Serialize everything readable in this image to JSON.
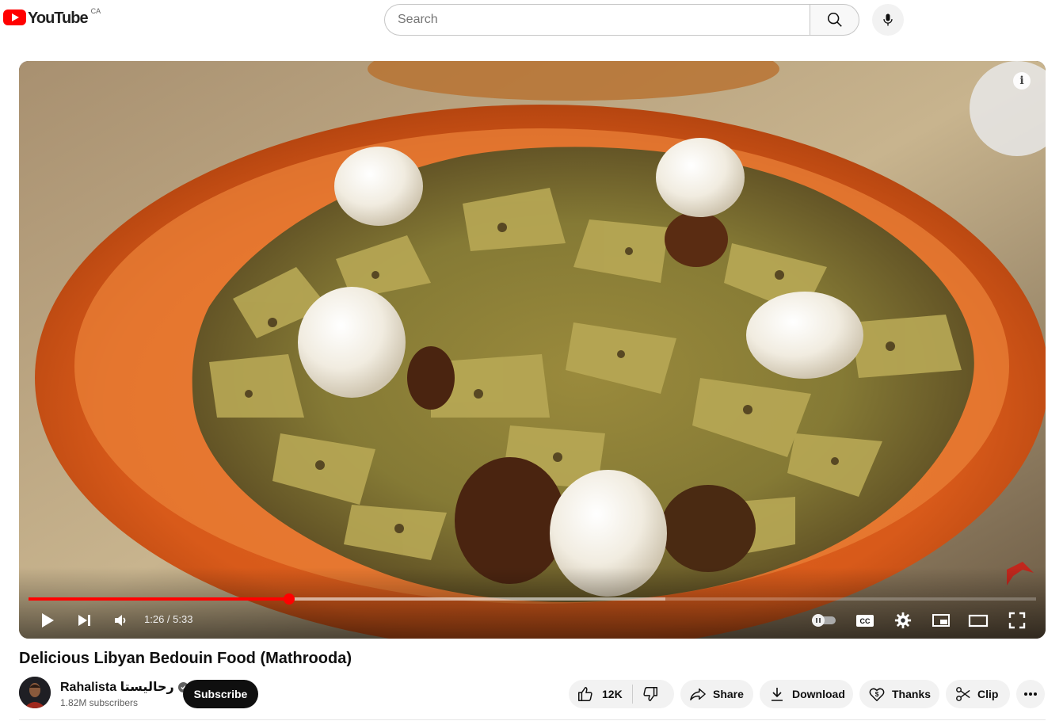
{
  "header": {
    "logo_text": "YouTube",
    "country_code": "CA",
    "search_placeholder": "Search",
    "icons": [
      "youtube-logo-icon",
      "search-icon",
      "microphone-icon"
    ]
  },
  "player": {
    "current_time": "1:26",
    "duration": "5:33",
    "time_display": "1:26 / 5:33",
    "played_fraction": 0.2584,
    "buffered_fraction": 0.6321,
    "accent_color": "#ff0000",
    "icons": [
      "info-icon",
      "play-icon",
      "next-icon",
      "volume-icon",
      "autoplay-toggle-icon",
      "captions-icon",
      "settings-icon",
      "miniplayer-icon",
      "theater-mode-icon",
      "fullscreen-icon",
      "channel-watermark-icon"
    ]
  },
  "video": {
    "title": "Delicious Libyan Bedouin Food (Mathrooda)"
  },
  "channel": {
    "name": "Rahalista رحاليستا",
    "subscribers": "1.82M subscribers",
    "subscribe_label": "Subscribe"
  },
  "actions": {
    "like_count": "12K",
    "share_label": "Share",
    "download_label": "Download",
    "thanks_label": "Thanks",
    "clip_label": "Clip"
  }
}
